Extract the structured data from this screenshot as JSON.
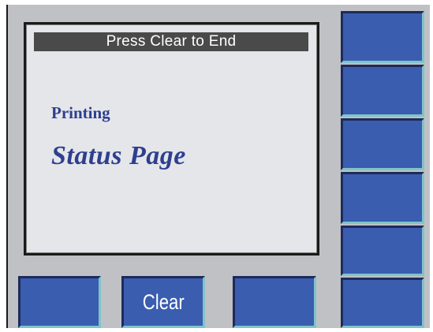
{
  "screen": {
    "banner": "Press Clear to End",
    "line1": "Printing",
    "line2": "Status Page"
  },
  "bottom_keys": [
    {
      "label": ""
    },
    {
      "label": "Clear"
    },
    {
      "label": ""
    },
    {
      "label": ""
    }
  ],
  "side_keys": [
    {
      "label": ""
    },
    {
      "label": ""
    },
    {
      "label": ""
    },
    {
      "label": ""
    },
    {
      "label": ""
    }
  ],
  "colors": {
    "panel_background": "#c0c1c5",
    "screen_background": "#e4e6e9",
    "banner_background": "#4a4a4a",
    "key_blue": "#3a5db0",
    "key_highlight": "#7fc4c8",
    "text_blue": "#2e3f8f"
  }
}
